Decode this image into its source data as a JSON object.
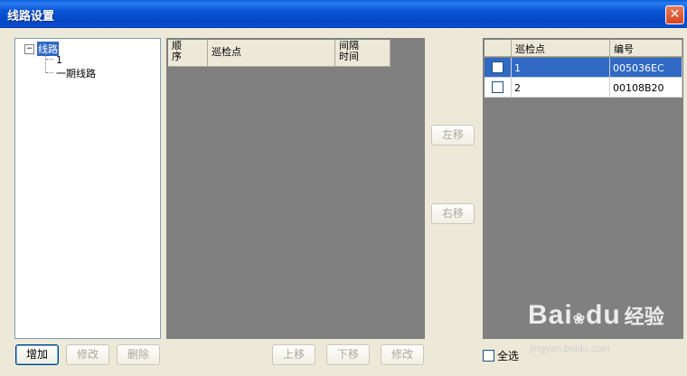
{
  "window": {
    "title": "线路设置",
    "close_label": "✕"
  },
  "tree": {
    "toggle": "−",
    "root": "线路",
    "children": [
      "1",
      "一期线路"
    ]
  },
  "middle_grid": {
    "headers": [
      "顺\n序",
      "巡检点",
      "间隔\n时间"
    ]
  },
  "right_grid": {
    "headers": [
      "",
      "巡检点",
      "编号"
    ],
    "rows": [
      {
        "name": "1",
        "code": "005036EC",
        "selected": true
      },
      {
        "name": "2",
        "code": "00108B20",
        "selected": false
      }
    ]
  },
  "buttons": {
    "add": "增加",
    "edit_route": "修改",
    "delete": "删除",
    "move_up": "上移",
    "move_down": "下移",
    "edit_point": "修改",
    "move_left": "左移",
    "move_right": "右移"
  },
  "select_all": "全选",
  "watermark": {
    "brand": "Bai",
    "brand2": "du",
    "cn": "经验",
    "url": "jingyan.baidu.com"
  },
  "colors": {
    "selection": "#316ac5",
    "title_bar": "#0a55d6",
    "grid_bg": "#808080"
  }
}
